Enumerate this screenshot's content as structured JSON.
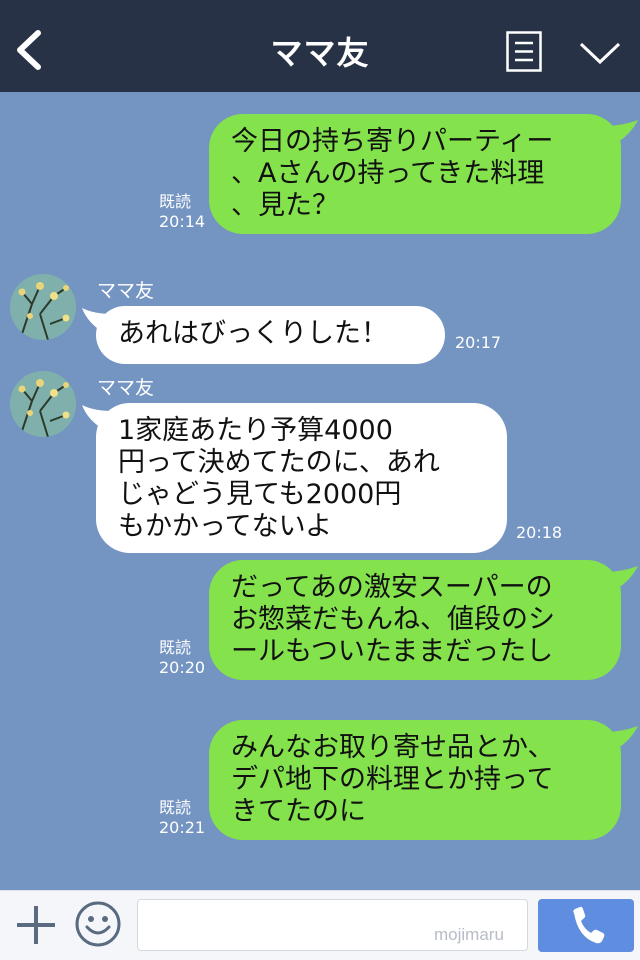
{
  "header": {
    "title": "ママ友",
    "back_icon": "chevron-left-icon",
    "menu_icon": "menu-list-icon",
    "dropdown_icon": "chevron-down-icon",
    "bg_color": "#273246"
  },
  "messages": [
    {
      "side": "me",
      "text": "今日の持ち寄りパーティー\n、Aさんの持ってきた料理\n、見た？",
      "read": "既読",
      "time": "20:14"
    },
    {
      "side": "them",
      "sender": "ママ友",
      "text": "あれはびっくりした！",
      "time": "20:17"
    },
    {
      "side": "them",
      "sender": "ママ友",
      "text": "1家庭あたり予算4000\n円って決めてたのに、あれ\nじゃどう見ても2000円\nもかかってないよ",
      "time": "20:18"
    },
    {
      "side": "me",
      "text": "だってあの激安スーパーの\nお惣菜だもんね、値段のシ\nールもついたままだったし",
      "read": "既読",
      "time": "20:20"
    },
    {
      "side": "me",
      "text": "みんなお取り寄せ品とか、\nデパ地下の料理とか持って\nきてたのに",
      "read": "既読",
      "time": "20:21"
    }
  ],
  "footer": {
    "plus_icon": "plus-icon",
    "emoji_icon": "smiley-icon",
    "input_value": "",
    "watermark": "mojimaru",
    "call_icon": "phone-icon"
  },
  "colors": {
    "background": "#7494c2",
    "my_bubble": "#84e24c",
    "their_bubble": "#ffffff",
    "call_button": "#5f8de0"
  }
}
